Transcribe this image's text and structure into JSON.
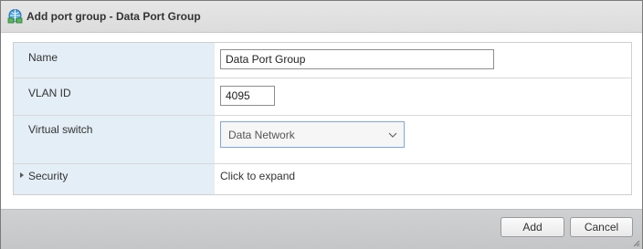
{
  "dialog": {
    "title": "Add port group - Data Port Group",
    "icon": "network-portgroup-icon"
  },
  "form": {
    "name": {
      "label": "Name",
      "value": "Data Port Group"
    },
    "vlan": {
      "label": "VLAN ID",
      "value": "4095"
    },
    "virtual_switch": {
      "label": "Virtual switch",
      "selected": "Data Network"
    },
    "security": {
      "label": "Security",
      "value": "Click to expand"
    }
  },
  "footer": {
    "add_label": "Add",
    "cancel_label": "Cancel"
  },
  "colors": {
    "label_column_bg": "#e4eef6",
    "select_border": "#7fa7d8",
    "footer_bg": "#c9cacc"
  }
}
